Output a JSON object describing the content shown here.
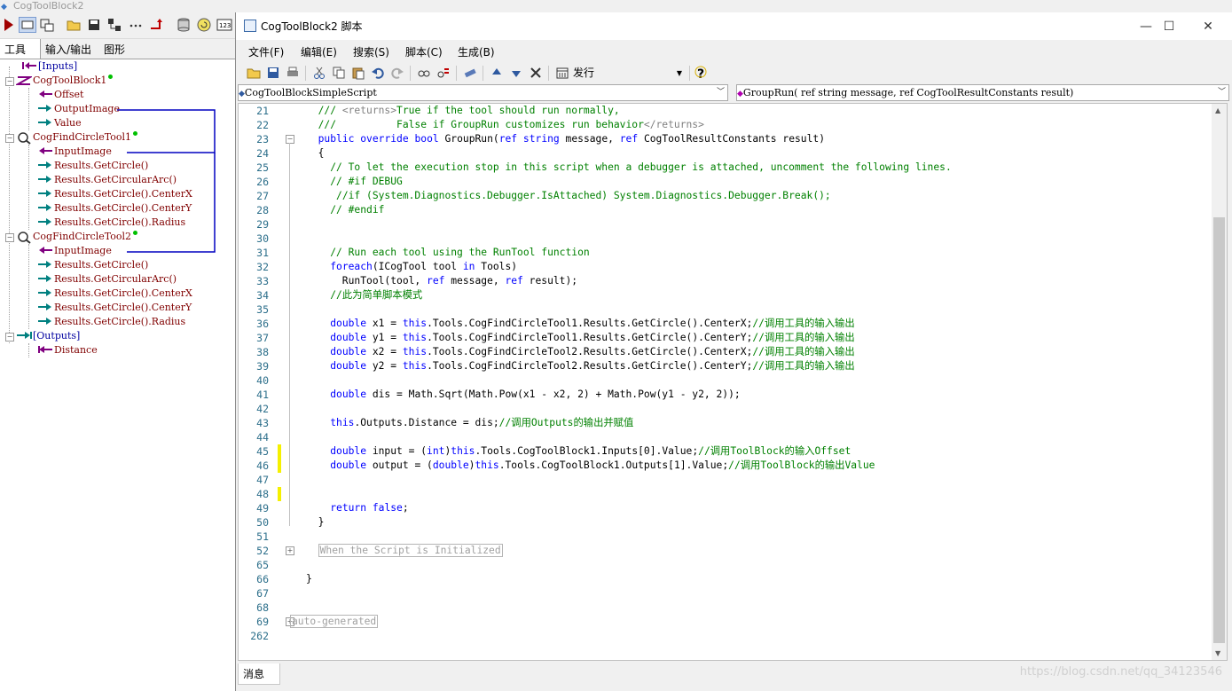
{
  "left_panel": {
    "title": "CogToolBlock2",
    "tabs": [
      "工具",
      "输入/输出",
      "图形"
    ],
    "tree": [
      {
        "label": "[Inputs]",
        "kind": "group",
        "color": "blue"
      },
      {
        "label": "CogToolBlock1",
        "kind": "tool",
        "color": "maroon"
      },
      {
        "label": "Offset",
        "kind": "input"
      },
      {
        "label": "OutputImage",
        "kind": "output"
      },
      {
        "label": "Value",
        "kind": "output"
      },
      {
        "label": "CogFindCircleTool1",
        "kind": "tool",
        "color": "maroon"
      },
      {
        "label": "InputImage",
        "kind": "input"
      },
      {
        "label": "Results.GetCircle()",
        "kind": "output"
      },
      {
        "label": "Results.GetCircularArc()",
        "kind": "output"
      },
      {
        "label": "Results.GetCircle().CenterX",
        "kind": "output"
      },
      {
        "label": "Results.GetCircle().CenterY",
        "kind": "output"
      },
      {
        "label": "Results.GetCircle().Radius",
        "kind": "output"
      },
      {
        "label": "CogFindCircleTool2",
        "kind": "tool",
        "color": "maroon"
      },
      {
        "label": "InputImage",
        "kind": "input"
      },
      {
        "label": "Results.GetCircle()",
        "kind": "output"
      },
      {
        "label": "Results.GetCircularArc()",
        "kind": "output"
      },
      {
        "label": "Results.GetCircle().CenterX",
        "kind": "output"
      },
      {
        "label": "Results.GetCircle().CenterY",
        "kind": "output"
      },
      {
        "label": "Results.GetCircle().Radius",
        "kind": "output"
      },
      {
        "label": "[Outputs]",
        "kind": "group",
        "color": "blue"
      },
      {
        "label": "Distance",
        "kind": "input"
      }
    ]
  },
  "window": {
    "title": "CogToolBlock2 脚本",
    "menus": [
      "文件(F)",
      "编辑(E)",
      "搜索(S)",
      "脚本(C)",
      "生成(B)"
    ],
    "toolbar_language": "发行",
    "class_combo": "CogToolBlockSimpleScript",
    "method_combo": "GroupRun( ref string message,  ref CogToolResultConstants result)",
    "bottom_tab": "消息",
    "watermark": "https://blog.csdn.net/qq_34123546"
  },
  "code_lines": [
    {
      "n": "21",
      "t": "  /// <returns>True if the tool should run normally,"
    },
    {
      "n": "22",
      "t": "  ///          False if GroupRun customizes run behavior</returns>"
    },
    {
      "n": "23",
      "t": "  public override bool GroupRun(ref string message, ref CogToolResultConstants result)"
    },
    {
      "n": "24",
      "t": "  {"
    },
    {
      "n": "25",
      "t": "    // To let the execution stop in this script when a debugger is attached, uncomment the following lines."
    },
    {
      "n": "26",
      "t": "    // #if DEBUG"
    },
    {
      "n": "27",
      "t": "     //if (System.Diagnostics.Debugger.IsAttached) System.Diagnostics.Debugger.Break();"
    },
    {
      "n": "28",
      "t": "    // #endif"
    },
    {
      "n": "29",
      "t": ""
    },
    {
      "n": "30",
      "t": ""
    },
    {
      "n": "31",
      "t": "    // Run each tool using the RunTool function"
    },
    {
      "n": "32",
      "t": "    foreach(ICogTool tool in Tools)"
    },
    {
      "n": "33",
      "t": "      RunTool(tool, ref message, ref result);"
    },
    {
      "n": "34",
      "t": "    //此为简单脚本模式"
    },
    {
      "n": "35",
      "t": ""
    },
    {
      "n": "36",
      "t": "    double x1 = this.Tools.CogFindCircleTool1.Results.GetCircle().CenterX;//调用工具的输入输出"
    },
    {
      "n": "37",
      "t": "    double y1 = this.Tools.CogFindCircleTool1.Results.GetCircle().CenterY;//调用工具的输入输出"
    },
    {
      "n": "38",
      "t": "    double x2 = this.Tools.CogFindCircleTool2.Results.GetCircle().CenterX;//调用工具的输入输出"
    },
    {
      "n": "39",
      "t": "    double y2 = this.Tools.CogFindCircleTool2.Results.GetCircle().CenterY;//调用工具的输入输出"
    },
    {
      "n": "40",
      "t": ""
    },
    {
      "n": "41",
      "t": "    double dis = Math.Sqrt(Math.Pow(x1 - x2, 2) + Math.Pow(y1 - y2, 2));"
    },
    {
      "n": "42",
      "t": ""
    },
    {
      "n": "43",
      "t": "    this.Outputs.Distance = dis;//调用Outputs的输出并赋值"
    },
    {
      "n": "44",
      "t": ""
    },
    {
      "n": "45",
      "t": "    double input = (int)this.Tools.CogToolBlock1.Inputs[0].Value;//调用ToolBlock的输入Offset"
    },
    {
      "n": "46",
      "t": "    double output = (double)this.Tools.CogToolBlock1.Outputs[1].Value;//调用ToolBlock的输出Value"
    },
    {
      "n": "47",
      "t": ""
    },
    {
      "n": "48",
      "t": ""
    },
    {
      "n": "49",
      "t": "    return false;"
    },
    {
      "n": "50",
      "t": "  }"
    },
    {
      "n": "51",
      "t": ""
    },
    {
      "n": "52",
      "t": "  When the Script is Initialized"
    },
    {
      "n": "65",
      "t": ""
    },
    {
      "n": "66",
      "t": "}"
    },
    {
      "n": "67",
      "t": ""
    },
    {
      "n": "68",
      "t": ""
    },
    {
      "n": "69",
      "t": "auto-generated"
    },
    {
      "n": "262",
      "t": ""
    }
  ],
  "colors": {
    "keyword": "#0000ff",
    "comment": "#008000",
    "tool_label": "#800000",
    "group_label": "#0000a0",
    "link_line": "#0000c0"
  }
}
